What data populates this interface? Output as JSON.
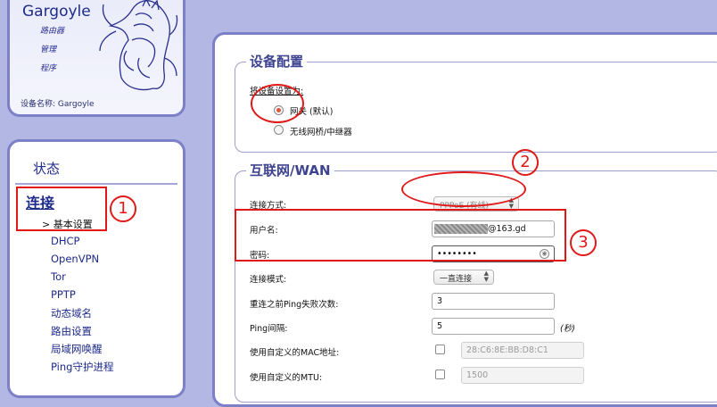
{
  "logo": {
    "brand": "Gargoyle",
    "menu": [
      "路由器",
      "管理",
      "程序"
    ],
    "device_name_label": "设备名称: Gargoyle"
  },
  "nav": {
    "status": "状态",
    "connection": "连接",
    "active_sub": "> 基本设置",
    "items": [
      "DHCP",
      "OpenVPN",
      "Tor",
      "PPTP",
      "动态域名",
      "路由设置",
      "局域网唤醒",
      "Ping守护进程"
    ]
  },
  "device_config": {
    "title": "设备配置",
    "prompt": "将设备设置为:",
    "options": [
      {
        "label": "网关 (默认)",
        "selected": true
      },
      {
        "label": "无线网桥/中继器",
        "selected": false
      }
    ]
  },
  "wan": {
    "title": "互联网/WAN",
    "connection_type_label": "连接方式:",
    "connection_type_value": "PPPoE (有线)",
    "username_label": "用户名:",
    "username_value": "@163.gd",
    "password_label": "密码:",
    "password_value": "••••••••",
    "connect_mode_label": "连接模式:",
    "connect_mode_value": "一直连接",
    "ping_fail_label": "重连之前Ping失败次数:",
    "ping_fail_value": "3",
    "ping_interval_label": "Ping间隔:",
    "ping_interval_value": "5",
    "ping_interval_unit": "(秒)",
    "custom_mac_label": "使用自定义的MAC地址:",
    "custom_mac_value": "28:C6:8E:BB:D8:C1",
    "custom_mac_checked": false,
    "custom_mtu_label": "使用自定义的MTU:",
    "custom_mtu_value": "1500",
    "custom_mtu_checked": false
  },
  "annotations": {
    "one": "1",
    "two": "2",
    "three": "3"
  },
  "colors": {
    "accent": "#1e2a8a",
    "annotation": "#e01818",
    "background": "#b3b7e4"
  }
}
